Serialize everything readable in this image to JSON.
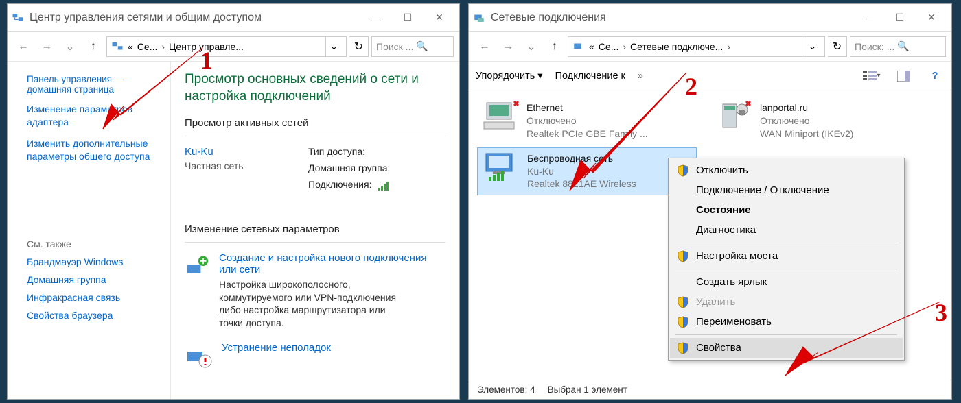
{
  "left": {
    "title": "Центр управления сетями и общим доступом",
    "breadcrumb": {
      "a": "Се...",
      "b": "Центр управле..."
    },
    "searchPlaceholder": "Поиск ...",
    "sidebar": {
      "cpHome": "Панель управления — домашняя страница",
      "adapters": "Изменение параметров адаптера",
      "advanced": "Изменить дополнительные параметры общего доступа",
      "seeAlso": "См. также",
      "firewall": "Брандмауэр Windows",
      "homegroup": "Домашняя группа",
      "infrared": "Инфракрасная связь",
      "browser": "Свойства браузера"
    },
    "heading": "Просмотр основных сведений о сети и настройка подключений",
    "activeLabel": "Просмотр активных сетей",
    "net": {
      "name": "Ku-Ku",
      "type": "Частная сеть",
      "access": "Тип доступа:",
      "homegroup": "Домашняя группа:",
      "connections": "Подключения:"
    },
    "changeLabel": "Изменение сетевых параметров",
    "opt1": {
      "link": "Создание и настройка нового подключения или сети",
      "desc": "Настройка широкополосного, коммутируемого или VPN-подключения либо настройка маршрутизатора или точки доступа."
    },
    "opt2": {
      "link": "Устранение неполадок"
    }
  },
  "right": {
    "title": "Сетевые подключения",
    "breadcrumb": {
      "a": "Се...",
      "b": "Сетевые подключе..."
    },
    "searchPlaceholder": "Поиск: ...",
    "toolbar": {
      "organize": "Упорядочить",
      "connectTo": "Подключение к"
    },
    "items": [
      {
        "name": "Ethernet",
        "status": "Отключено",
        "device": "Realtek PCIe GBE Family ..."
      },
      {
        "name": "lanportal.ru",
        "status": "Отключено",
        "device": "WAN Miniport (IKEv2)"
      },
      {
        "name": "Беспроводная сеть",
        "status": "Ku-Ku",
        "device": "Realtek 8821AE Wireless"
      }
    ],
    "ctx": {
      "disable": "Отключить",
      "connect": "Подключение / Отключение",
      "status": "Состояние",
      "diag": "Диагностика",
      "bridge": "Настройка моста",
      "shortcut": "Создать ярлык",
      "delete": "Удалить",
      "rename": "Переименовать",
      "props": "Свойства"
    },
    "status": {
      "count": "Элементов: 4",
      "selected": "Выбран 1 элемент"
    }
  },
  "annot": {
    "n1": "1",
    "n2": "2",
    "n3": "3"
  }
}
